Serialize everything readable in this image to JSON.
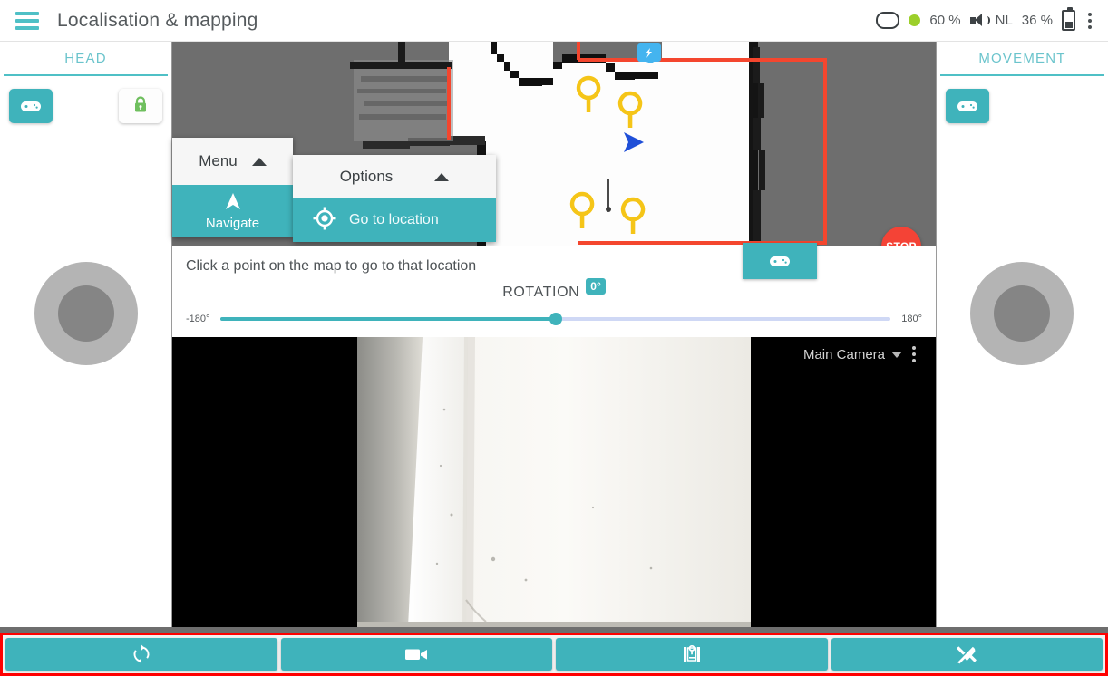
{
  "appbar": {
    "menu_icon": "hamburger-icon",
    "title": "Localisation & mapping",
    "status": {
      "screen_icon": "screen-icon",
      "connection_dot": "green-status-dot",
      "screen_brightness": "60 %",
      "volume_icon": "speaker-icon",
      "language": "NL",
      "battery_level": "36 %",
      "battery_icon": "battery-icon",
      "overflow_icon": "kebab-menu-icon"
    }
  },
  "left_panel": {
    "title": "HEAD",
    "gamepad_icon": "gamepad-icon",
    "lock_icon": "lock-icon",
    "joystick": "head-joystick"
  },
  "right_panel": {
    "title": "MOVEMENT",
    "gamepad_icon": "gamepad-icon",
    "joystick": "movement-joystick"
  },
  "map": {
    "stop_label": "STOP",
    "robot_marker": "robot-heading-arrow",
    "location_markers": 4,
    "charging_marker": "charging-station-marker",
    "boundary_color": "#f4462e"
  },
  "menu_card": {
    "header": "Menu",
    "caret_icon": "caret-up-icon",
    "item_label": "Navigate",
    "item_icon": "navigate-arrow-icon"
  },
  "options_card": {
    "header": "Options",
    "caret_icon": "caret-up-icon",
    "item_label": "Go to location",
    "item_icon": "target-crosshair-icon"
  },
  "instruction": {
    "text": "Click a point on the map to go to that location",
    "gamepad_icon": "gamepad-icon"
  },
  "rotation": {
    "label": "ROTATION",
    "value": "0°",
    "min_label": "-180°",
    "max_label": "180°",
    "min": -180,
    "max": 180,
    "current": 0
  },
  "camera": {
    "source_label": "Main Camera",
    "dropdown_icon": "chevron-down-icon",
    "overflow_icon": "kebab-menu-icon"
  },
  "toolbar": {
    "buttons": [
      {
        "name": "refresh-button",
        "icon": "refresh-icon"
      },
      {
        "name": "record-video-button",
        "icon": "video-camera-icon"
      },
      {
        "name": "map-button",
        "icon": "map-icon"
      },
      {
        "name": "tools-button",
        "icon": "tools-icon"
      }
    ]
  },
  "colors": {
    "accent": "#3fb3bb",
    "accent_light": "#4fc0c6",
    "stop": "#f44336",
    "highlight_border": "#ff0000",
    "marker": "#f5c518",
    "robot": "#1f4fd8",
    "background": "#6e6e6e"
  }
}
